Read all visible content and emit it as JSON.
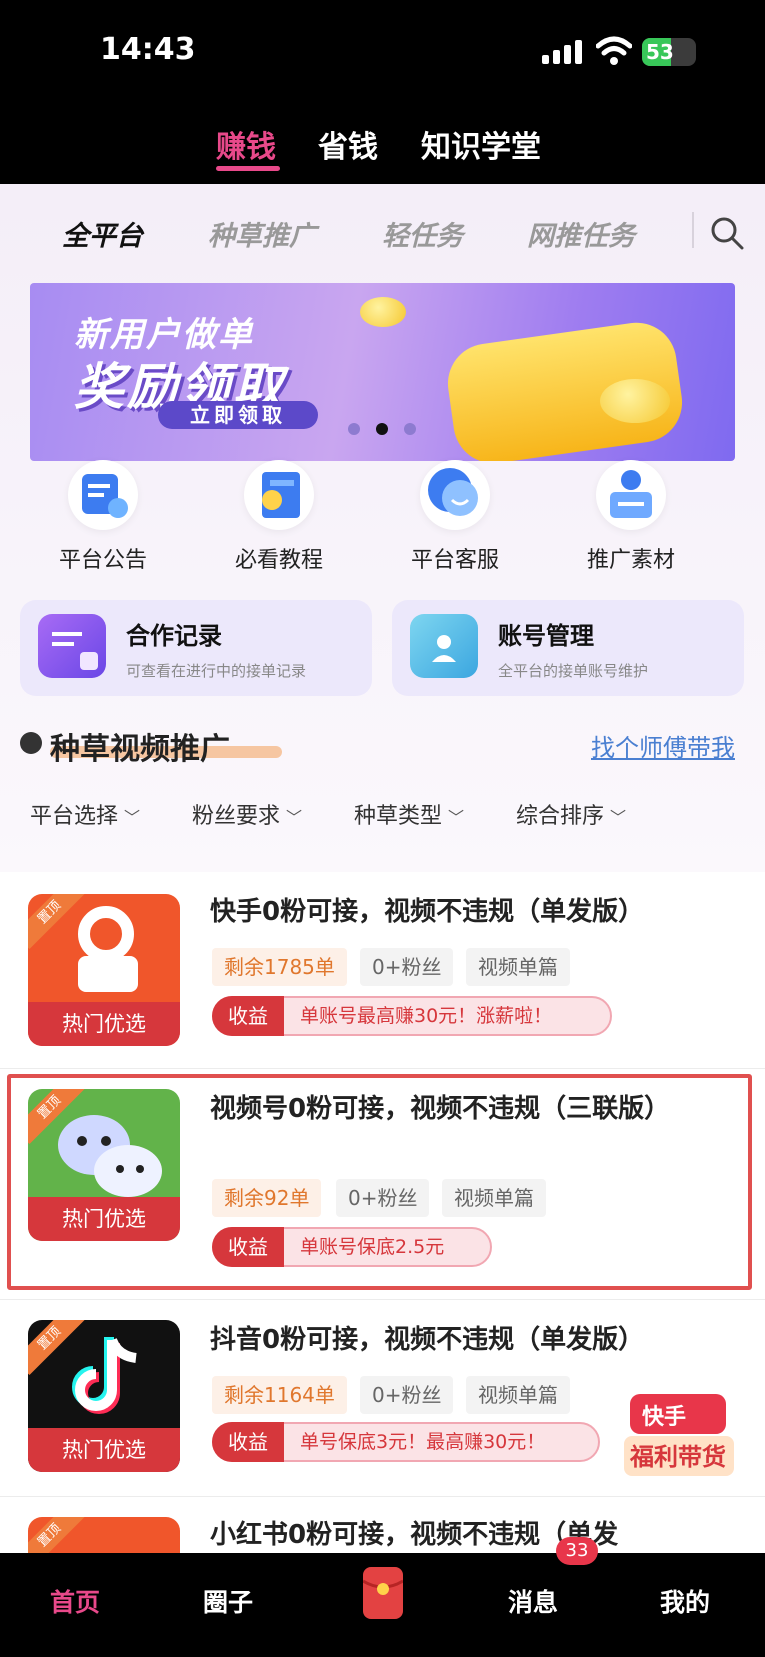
{
  "status_bar": {
    "time": "14:43",
    "battery": "53",
    "battery_level": 0.53
  },
  "top_nav": {
    "tabs": [
      "赚钱",
      "省钱",
      "知识学堂"
    ],
    "active": 0
  },
  "category_tabs": {
    "items": [
      "全平台",
      "种草推广",
      "轻任务",
      "网推任务"
    ],
    "active": 0
  },
  "banner": {
    "line1": "新用户做单",
    "line2": "奖励领取",
    "button": "立即领取",
    "dots": 3,
    "active_dot": 1
  },
  "quick_links": [
    {
      "label": "平台公告",
      "icon": "announcement-icon"
    },
    {
      "label": "必看教程",
      "icon": "tutorial-icon"
    },
    {
      "label": "平台客服",
      "icon": "customer-service-icon"
    },
    {
      "label": "推广素材",
      "icon": "promo-material-icon"
    }
  ],
  "cards": [
    {
      "title": "合作记录",
      "subtitle": "可查看在进行中的接单记录"
    },
    {
      "title": "账号管理",
      "subtitle": "全平台的接单账号维护"
    }
  ],
  "section": {
    "title": "种草视频推广",
    "link": "找个师傅带我"
  },
  "filters": [
    "平台选择",
    "粉丝要求",
    "种草类型",
    "综合排序"
  ],
  "tasks": [
    {
      "title": "快手0粉可接，视频不违规（单发版）",
      "remaining": "剩余1785单",
      "fans": "0+粉丝",
      "type": "视频单篇",
      "income_label": "收益",
      "income": "单账号最高赚30元！涨薪啦！",
      "tag": "热门优选",
      "ribbon": "置顶",
      "platform": "kuaishou",
      "color": "#f0562b"
    },
    {
      "title": "视频号0粉可接，视频不违规（三联版）",
      "remaining": "剩余92单",
      "fans": "0+粉丝",
      "type": "视频单篇",
      "income_label": "收益",
      "income": "单账号保底2.5元",
      "tag": "热门优选",
      "ribbon": "置顶",
      "platform": "wechat-channels",
      "color": "#62b34a"
    },
    {
      "title": "抖音0粉可接，视频不违规（单发版）",
      "remaining": "剩余1164单",
      "fans": "0+粉丝",
      "type": "视频单篇",
      "income_label": "收益",
      "income": "单号保底3元！最高赚30元！",
      "tag": "热门优选",
      "ribbon": "置顶",
      "platform": "douyin",
      "color": "#111111"
    },
    {
      "title": "小红书0粉可接，视频不违规（单发",
      "ribbon": "置顶",
      "platform": "xiaohongshu",
      "color": "#f0562b"
    }
  ],
  "promo": {
    "line1": "快手",
    "line2": "福利带货"
  },
  "bottom_nav": {
    "items": [
      "首页",
      "圈子",
      "消息",
      "我的"
    ],
    "badge": "33",
    "active": 0
  }
}
